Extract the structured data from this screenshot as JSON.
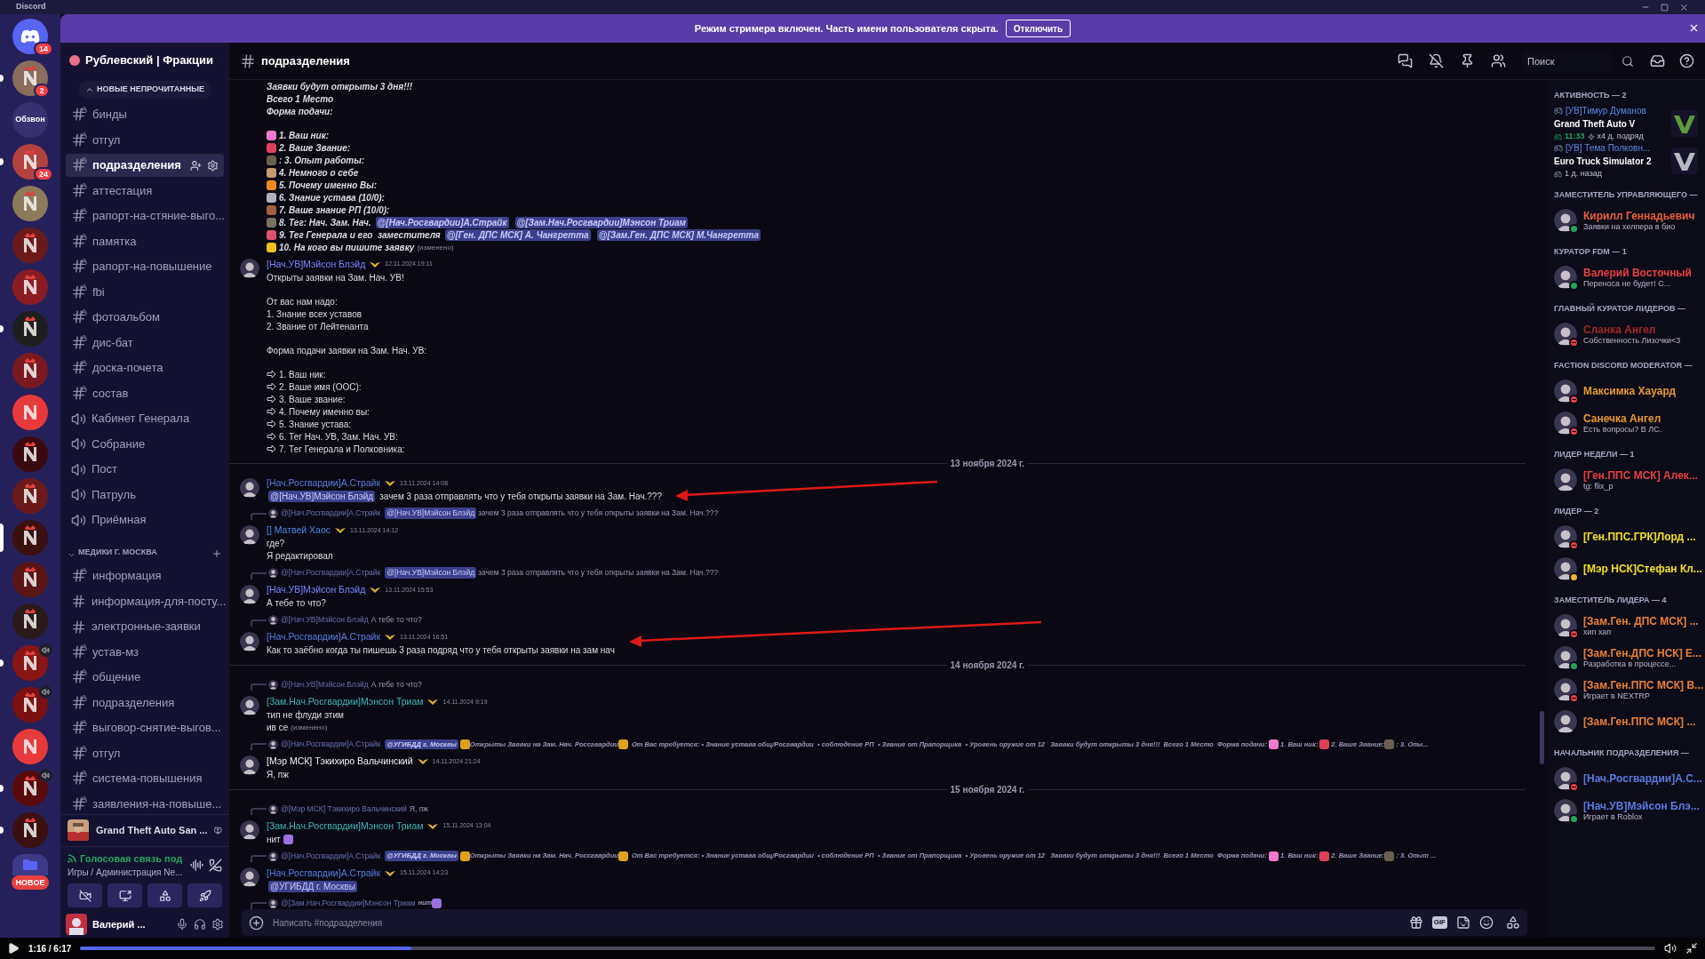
{
  "app_title": "Discord",
  "banner": {
    "text": "Режим стримера включен. Часть имени пользователя скрыта.",
    "button": "Отключить"
  },
  "servers": [
    {
      "kind": "home",
      "badge": "14",
      "color": "#5865f2",
      "selected": false,
      "unread": false,
      "in_voice": false
    },
    {
      "kind": "picture",
      "badge": "2",
      "color": "#8a6d5c",
      "selected": false,
      "unread": true,
      "in_voice": false
    },
    {
      "kind": "text",
      "label": "Обзвон",
      "color": "#363170",
      "selected": false,
      "unread": false,
      "in_voice": false
    },
    {
      "kind": "picture",
      "badge": "24",
      "color": "#b3413e",
      "selected": false,
      "unread": true,
      "in_voice": false
    },
    {
      "kind": "picture",
      "color": "#8b7b5a",
      "selected": false,
      "unread": false,
      "in_voice": false
    },
    {
      "kind": "picture",
      "color": "#6b1a1a",
      "selected": false,
      "unread": false,
      "in_voice": false
    },
    {
      "kind": "picture",
      "color": "#8a1c22",
      "selected": false,
      "unread": false,
      "in_voice": false
    },
    {
      "kind": "picture",
      "color": "#1e1e1e",
      "selected": false,
      "unread": true,
      "in_voice": false
    },
    {
      "kind": "picture",
      "color": "#7a1a20",
      "selected": false,
      "unread": false,
      "in_voice": false
    },
    {
      "kind": "picture",
      "color": "#e83a3a",
      "selected": false,
      "unread": false,
      "in_voice": false
    },
    {
      "kind": "picture",
      "color": "#3a0a10",
      "selected": false,
      "unread": false,
      "in_voice": false
    },
    {
      "kind": "picture",
      "color": "#6a1a1a",
      "selected": false,
      "unread": false,
      "in_voice": false
    },
    {
      "kind": "picture",
      "color": "#3a1010",
      "selected": true,
      "unread": false,
      "in_voice": false
    },
    {
      "kind": "picture",
      "color": "#5a1515",
      "selected": false,
      "unread": false,
      "in_voice": false
    },
    {
      "kind": "picture",
      "color": "#2a1a1a",
      "selected": false,
      "unread": false,
      "in_voice": false
    },
    {
      "kind": "picture",
      "color": "#8a1515",
      "selected": false,
      "unread": true,
      "in_voice": true
    },
    {
      "kind": "picture",
      "color": "#7a1010",
      "selected": false,
      "unread": false,
      "in_voice": true
    },
    {
      "kind": "picture",
      "color": "#e83a3a",
      "selected": false,
      "unread": false,
      "in_voice": false
    },
    {
      "kind": "picture",
      "color": "#5a0a0a",
      "selected": false,
      "unread": true,
      "in_voice": true
    },
    {
      "kind": "picture",
      "color": "#3a1010",
      "selected": false,
      "unread": true,
      "in_voice": false
    },
    {
      "kind": "folder",
      "badge": "НОВОЕ",
      "color": "#5865f2",
      "selected": false,
      "unread": false,
      "in_voice": false
    }
  ],
  "sidebar": {
    "server_name": "Рублевский | Фракции",
    "unread_pill": "НОВЫЕ НЕПРОЧИТАННЫЕ",
    "channels": [
      {
        "name": "бинды",
        "kind": "locked",
        "selected": false
      },
      {
        "name": "отгул",
        "kind": "locked",
        "selected": false
      },
      {
        "name": "подразделения",
        "kind": "locked",
        "selected": true
      },
      {
        "name": "аттестация",
        "kind": "locked",
        "selected": false
      },
      {
        "name": "рапорт-на-стяние-выго...",
        "kind": "locked",
        "selected": false
      },
      {
        "name": "памятка",
        "kind": "locked",
        "selected": false
      },
      {
        "name": "рапорт-на-повышение",
        "kind": "locked",
        "selected": false
      },
      {
        "name": "fbi",
        "kind": "locked",
        "selected": false
      },
      {
        "name": "фотоальбом",
        "kind": "locked",
        "selected": false
      },
      {
        "name": "дис-бат",
        "kind": "locked",
        "selected": false
      },
      {
        "name": "доска-почета",
        "kind": "locked",
        "selected": false
      },
      {
        "name": "состав",
        "kind": "locked",
        "selected": false
      },
      {
        "name": "Кабинет Генерала",
        "kind": "voice",
        "selected": false
      },
      {
        "name": "Собрание",
        "kind": "voice",
        "selected": false
      },
      {
        "name": "Пост",
        "kind": "voice",
        "selected": false
      },
      {
        "name": "Патруль",
        "kind": "voice",
        "selected": false
      },
      {
        "name": "Приёмная",
        "kind": "voice",
        "selected": false
      }
    ],
    "category": {
      "name": "МЕДИКИ Г. МОСКВА",
      "expanded": true,
      "channels": [
        {
          "name": "информация",
          "kind": "locked",
          "selected": false
        },
        {
          "name": "информация-для-посту...",
          "kind": "text",
          "selected": false
        },
        {
          "name": "электронные-заявки",
          "kind": "text",
          "selected": false
        },
        {
          "name": "устав-мз",
          "kind": "locked",
          "selected": false
        },
        {
          "name": "общение",
          "kind": "locked",
          "selected": false
        },
        {
          "name": "подразделения",
          "kind": "locked",
          "selected": false
        },
        {
          "name": "выговор-снятие-выгов...",
          "kind": "locked",
          "selected": false
        },
        {
          "name": "отгул",
          "kind": "locked",
          "selected": false
        },
        {
          "name": "система-повышения",
          "kind": "locked",
          "selected": false
        },
        {
          "name": "заявления-на-повыше...",
          "kind": "locked",
          "selected": false
        }
      ]
    },
    "activity": "Grand Theft Auto San ...",
    "voice": {
      "status": "Голосовая связь под",
      "location": "Игры / Администрация Ne..."
    },
    "user": {
      "name": "Валерий ..."
    }
  },
  "chat": {
    "channel": "подразделения",
    "search_placeholder": "Поиск",
    "composer_placeholder": "Написать #подразделения",
    "gif_label": "GIF"
  },
  "messages": [
    {
      "kind": "continuation",
      "lines": [
        {
          "kind": "text",
          "text": "Заявки будут открыты 3 дня!!!"
        },
        {
          "kind": "text",
          "text": "Всего 1 Место"
        },
        {
          "kind": "text",
          "text": "Форма подачи:"
        },
        {
          "kind": "gap"
        },
        {
          "kind": "emoji_item",
          "color": "#f07ad0",
          "text": "1. Ваш ник:"
        },
        {
          "kind": "emoji_item",
          "color": "#e0405a",
          "text": "2. Ваше Звание:"
        },
        {
          "kind": "emoji_item",
          "color": "#6a6050",
          "text": ": 3. Опыт работы:"
        },
        {
          "kind": "emoji_item",
          "color": "#c89a70",
          "text": "4. Немного о себе"
        },
        {
          "kind": "emoji_item",
          "color": "#f08a20",
          "text": "5. Почему именно Вы:"
        },
        {
          "kind": "emoji_item",
          "color": "#b0b0c0",
          "text": "6. Знание устава (10/0):"
        },
        {
          "kind": "emoji_item",
          "color": "#a06040",
          "text": "7. Ваше знание РП (10/0):"
        },
        {
          "kind": "emoji_item",
          "color": "#7a7060",
          "parts": [
            {
              "kind": "text",
              "text": "8. Тег: Нач. Зам. Нач."
            },
            {
              "kind": "mention",
              "text": "@[Нач.Росгвардии]А.Страйк"
            },
            {
              "kind": "mention",
              "text": "@[Зам.Нач.Росгвардии]Мэнсон Триам"
            }
          ]
        },
        {
          "kind": "emoji_item",
          "color": "#e05070",
          "parts": [
            {
              "kind": "text",
              "text": "9. Тег Генерала и его  заместителя"
            },
            {
              "kind": "mention",
              "text": "@[Ген. ДПС МСК] А. Чангретта"
            },
            {
              "kind": "mention",
              "text": "@[Зам.Ген. ДПС МСК] М.Чангретта"
            }
          ]
        },
        {
          "kind": "emoji_item",
          "color": "#f0c020",
          "text": "10. На кого вы пишите заявку",
          "edited": "(изменено)"
        }
      ]
    },
    {
      "kind": "message",
      "author": "[Нач.УВ]Мэйсон Блэйд",
      "color": "#7b86ff",
      "time": "12.11.2024 19:11",
      "lines": [
        {
          "kind": "text",
          "text": "Открыты заявки на Зам. Нач. УВ!"
        },
        {
          "kind": "gap"
        },
        {
          "kind": "text",
          "text": "От вас нам надо:"
        },
        {
          "kind": "text",
          "text": "1. Знание всех уставов"
        },
        {
          "kind": "text",
          "text": "2. Звание от Лейтенанта"
        },
        {
          "kind": "gap"
        },
        {
          "kind": "text",
          "text": "Форма подачи заявки на Зам. Нач. УВ:"
        },
        {
          "kind": "gap"
        },
        {
          "kind": "arrow_item",
          "text": "1. Ваш ник:"
        },
        {
          "kind": "arrow_item",
          "text": "2. Ваше имя (ООС):"
        },
        {
          "kind": "arrow_item",
          "text": "3. Ваше звание:"
        },
        {
          "kind": "arrow_item",
          "text": "4. Почему именно вы:"
        },
        {
          "kind": "arrow_item",
          "text": "5. Знание устава:"
        },
        {
          "kind": "arrow_item",
          "text": "6. Тег Нач. УВ, Зам. Нач. УВ:"
        },
        {
          "kind": "arrow_item",
          "text": "7. Тег Генерала и Полковника:"
        }
      ]
    },
    {
      "kind": "divider",
      "text": "13 ноября 2024 г."
    },
    {
      "kind": "message",
      "author": "[Нач.Росгвардии]А.Страйк",
      "color": "#5b7be0",
      "time": "13.11.2024 14:08",
      "lines": [
        {
          "kind": "text",
          "parts": [
            {
              "kind": "mention",
              "text": "@[Нач.УВ]Мэйсон Блэйд"
            },
            {
              "kind": "text",
              "text": "зачем 3 раза отправлять что у тебя открыты заявки на Зам. Нач.???"
            }
          ]
        }
      ]
    },
    {
      "kind": "reply",
      "author": "@[Нач.Росгвардии]А.Страйк",
      "parts": [
        {
          "kind": "mention",
          "text": "@[Нач.УВ]Мэйсон Блэйд"
        },
        {
          "kind": "text",
          "text": "зачем 3 раза отправлять что у тебя открыты заявки на Зам. Нач.???"
        }
      ]
    },
    {
      "kind": "message",
      "author": "[] Матвей Хаос",
      "color": "#4f86e8",
      "time": "13.11.2024 14:12",
      "lines": [
        {
          "kind": "text",
          "text": "где?"
        },
        {
          "kind": "text",
          "text": "Я редактировал"
        }
      ]
    },
    {
      "kind": "reply",
      "author": "@[Нач.Росгвардии]А.Страйк",
      "parts": [
        {
          "kind": "mention",
          "text": "@[Нач.УВ]Мэйсон Блэйд"
        },
        {
          "kind": "text",
          "text": "зачем 3 раза отправлять что у тебя открыты заявки на Зам. Нач.???"
        }
      ]
    },
    {
      "kind": "message",
      "author": "[Нач.УВ]Мэйсон Блэйд",
      "color": "#7b86ff",
      "time": "13.11.2024 15:53",
      "lines": [
        {
          "kind": "text",
          "text": "А тебе то что?"
        }
      ]
    },
    {
      "kind": "reply",
      "author": "@[Нач.УВ]Мэйсон Блэйд",
      "parts": [
        {
          "kind": "text",
          "text": "А тебе то что?"
        }
      ]
    },
    {
      "kind": "message",
      "author": "[Нач.Росгвардии]А.Страйк",
      "color": "#5b7be0",
      "time": "13.11.2024 16:51",
      "lines": [
        {
          "kind": "text",
          "text": "Как то заёбно когда ты пишешь 3 раза подряд что у тебя открыты заявки на зам нач"
        }
      ]
    },
    {
      "kind": "divider",
      "text": "14 ноября 2024 г."
    },
    {
      "kind": "reply",
      "author": "@[Нач.УВ]Мэйсон Блэйд",
      "parts": [
        {
          "kind": "text",
          "text": "А тебе то что?"
        }
      ]
    },
    {
      "kind": "message",
      "author": "[Зам.Нач.Росгвардии]Мэнсон Триам",
      "color": "#3fb5b5",
      "time": "14.11.2024 9:19",
      "lines": [
        {
          "kind": "text",
          "text": "тип не флуди этим"
        },
        {
          "kind": "text",
          "text": "ив се",
          "edited": "(изменено)"
        }
      ]
    },
    {
      "kind": "reply",
      "author": "@[Нач.Росгвардии]А.Страйк",
      "parts": [
        {
          "kind": "mention",
          "text": "@УГИБДД г. Москвы"
        },
        {
          "kind": "emoji",
          "color": "#e0a020"
        },
        {
          "kind": "text",
          "text": "Открыты Заявки на Зам. Нач. Россгвардии"
        },
        {
          "kind": "emoji",
          "color": "#e0a020"
        },
        {
          "kind": "text",
          "text": "  От Вас требуется: • Знание устава общ/Росгвардии  • соблюдение РП  • Звание от Прапорщика  • Уровень оружие от 12   Заявки будут открыты 3 дня!!!  Всего 1 Место  Форма подачи: "
        },
        {
          "kind": "emoji",
          "color": "#f07ad0"
        },
        {
          "kind": "text",
          "text": " 1. Ваш ник: "
        },
        {
          "kind": "emoji",
          "color": "#e0405a"
        },
        {
          "kind": "text",
          "text": " 2. Ваше Звание:"
        },
        {
          "kind": "emoji",
          "color": "#6a6050"
        },
        {
          "kind": "text",
          "text": " : 3. Опы..."
        }
      ]
    },
    {
      "kind": "message",
      "author": "[Мэр МСК] Тэкихиро Вальчинский",
      "color": "#f2f3f5",
      "time": "14.11.2024 21:24",
      "lines": [
        {
          "kind": "text",
          "text": "Я, пж"
        }
      ]
    },
    {
      "kind": "divider",
      "text": "15 ноября 2024 г."
    },
    {
      "kind": "reply",
      "author": "@[Мэр МСК] Тэкихиро Вальчинский",
      "parts": [
        {
          "kind": "text",
          "text": "Я, пж"
        }
      ]
    },
    {
      "kind": "message",
      "author": "[Зам.Нач.Росгвардии]Мэнсон Триам",
      "color": "#3fb5b5",
      "time": "15.11.2024 13:04",
      "lines": [
        {
          "kind": "text",
          "parts": [
            {
              "kind": "text",
              "text": "нит"
            },
            {
              "kind": "emoji",
              "color": "#9a70e0"
            }
          ]
        }
      ]
    },
    {
      "kind": "reply",
      "author": "@[Нач.Росгвардии]А.Страйк",
      "parts": [
        {
          "kind": "mention",
          "text": "@УГИБДД г. Москвы"
        },
        {
          "kind": "emoji",
          "color": "#e0a020"
        },
        {
          "kind": "text",
          "text": "Открыты Заявки на Зам. Нач. Россгвардии"
        },
        {
          "kind": "emoji",
          "color": "#e0a020"
        },
        {
          "kind": "text",
          "text": "  От Вас требуется: • Знание устава общ/Росгвардии  • соблюдение РП  • Звание от Прапорщика  • Уровень оружие от 12   Заявки будут открыты 3 дня!!!  Всего 1 Место  Форма подачи: "
        },
        {
          "kind": "emoji",
          "color": "#f07ad0"
        },
        {
          "kind": "text",
          "text": " 1. Ваш ник: "
        },
        {
          "kind": "emoji",
          "color": "#e0405a"
        },
        {
          "kind": "text",
          "text": " 2. Ваше Звание:"
        },
        {
          "kind": "emoji",
          "color": "#6a6050"
        },
        {
          "kind": "text",
          "text": " : 3. Опыт ..."
        }
      ]
    },
    {
      "kind": "message",
      "author": "[Нач.Росгвардии]А.Страйк",
      "color": "#5b7be0",
      "time": "15.11.2024 14:23",
      "lines": [
        {
          "kind": "text",
          "parts": [
            {
              "kind": "mention",
              "text": "@УГИБДД г. Москвы"
            }
          ]
        }
      ]
    },
    {
      "kind": "reply",
      "author": "@[Зам.Нач.Росгвардии]Мэнсон Триам",
      "parts": [
        {
          "kind": "text",
          "text": "нит"
        },
        {
          "kind": "emoji",
          "color": "#9a70e0"
        }
      ]
    }
  ],
  "members": [
    {
      "kind": "section",
      "title": "АКТИВНОСТЬ — 2"
    },
    {
      "kind": "activity",
      "name": "[УВ]Тимур Думанов",
      "game": "Grand Theft Auto V",
      "time": "11:33",
      "streak": "x4 д. подряд"
    },
    {
      "kind": "activity",
      "name": "[УВ] Тема Полковн...",
      "game": "Euro Truck Simulator 2",
      "ago": "1 д. назад"
    },
    {
      "kind": "section",
      "title": "ЗАМЕСТИТЕЛЬ УПРАВЛЯЮЩЕГО —"
    },
    {
      "kind": "member",
      "name": "Кирилл Геннадьевич",
      "color": "#e8603a",
      "status": "Заявки на хелпера в био",
      "online": true,
      "do_not_disturb": false,
      "idle": false
    },
    {
      "kind": "section",
      "title": "КУРАТОР FDM — 1"
    },
    {
      "kind": "member",
      "name": "Валерий Восточный",
      "color": "#e84040",
      "status": "Переноса не будет! С...",
      "online": true,
      "do_not_disturb": false,
      "idle": false
    },
    {
      "kind": "section",
      "title": "ГЛАВНЫЙ КУРАТОР ЛИДЕРОВ —"
    },
    {
      "kind": "member",
      "name": "Сланка Ангел",
      "color": "#a02828",
      "status": "Собственность Лизочки<3",
      "online": false,
      "do_not_disturb": true,
      "idle": false
    },
    {
      "kind": "section",
      "title": "FACTION DISCORD MODERATOR —"
    },
    {
      "kind": "member",
      "name": "Максимка Хауард",
      "color": "#e89a30",
      "online": false,
      "do_not_disturb": true,
      "idle": false
    },
    {
      "kind": "member",
      "name": "Санечка Ангел",
      "color": "#e89a30",
      "status": "Есть вопросы? В ЛС.",
      "online": false,
      "do_not_disturb": true,
      "idle": false
    },
    {
      "kind": "section",
      "title": "ЛИДЕР НЕДЕЛИ — 1"
    },
    {
      "kind": "member",
      "name": "[Ген.ППС МСК] Алек...",
      "color": "#e84040",
      "status": "tg: flix_p",
      "online": false,
      "do_not_disturb": false,
      "idle": false
    },
    {
      "kind": "section",
      "title": "ЛИДЕР — 2"
    },
    {
      "kind": "member",
      "name": "[Ген.ППС.ГРК]Лорд ...",
      "color": "#f0e020",
      "online": false,
      "do_not_disturb": true,
      "idle": false
    },
    {
      "kind": "member",
      "name": "[Мэр НСК]Стефан Кл...",
      "color": "#f0e020",
      "online": false,
      "do_not_disturb": false,
      "idle": true
    },
    {
      "kind": "section",
      "title": "ЗАМЕСТИТЕЛЬ ЛИДЕРА — 4"
    },
    {
      "kind": "member",
      "name": "[Зам.Ген. ДПС МСК] ...",
      "color": "#e8803a",
      "status": "хип хап",
      "online": false,
      "do_not_disturb": true,
      "idle": false
    },
    {
      "kind": "member",
      "name": "[Зам.Ген.ДПС НСК] Е...",
      "color": "#e8803a",
      "status": "Разработка в процессе...",
      "online": true,
      "do_not_disturb": false,
      "idle": false
    },
    {
      "kind": "member",
      "name": "[Зам.Ген.ППС МСК] В...",
      "color": "#e8803a",
      "status": "Играет в NEXTRP",
      "online": false,
      "do_not_disturb": true,
      "idle": false
    },
    {
      "kind": "member",
      "name": "[Зам.Ген.ППС МСК] ...",
      "color": "#e8803a",
      "online": false,
      "do_not_disturb": false,
      "idle": false
    },
    {
      "kind": "section",
      "title": "НАЧАЛЬНИК ПОДРАЗДЕЛЕНИЯ —"
    },
    {
      "kind": "member",
      "name": "[Нач.Росгвардии]А.С...",
      "color": "#5b7be0",
      "online": false,
      "do_not_disturb": true,
      "idle": false
    },
    {
      "kind": "member",
      "name": "[Нач.УВ]Мэйсон Блэ...",
      "color": "#5b7be0",
      "status": "Играет в Roblox",
      "online": true,
      "do_not_disturb": false,
      "idle": false
    }
  ],
  "player": {
    "time": "1:16 / 6:17",
    "level": 0.21
  }
}
